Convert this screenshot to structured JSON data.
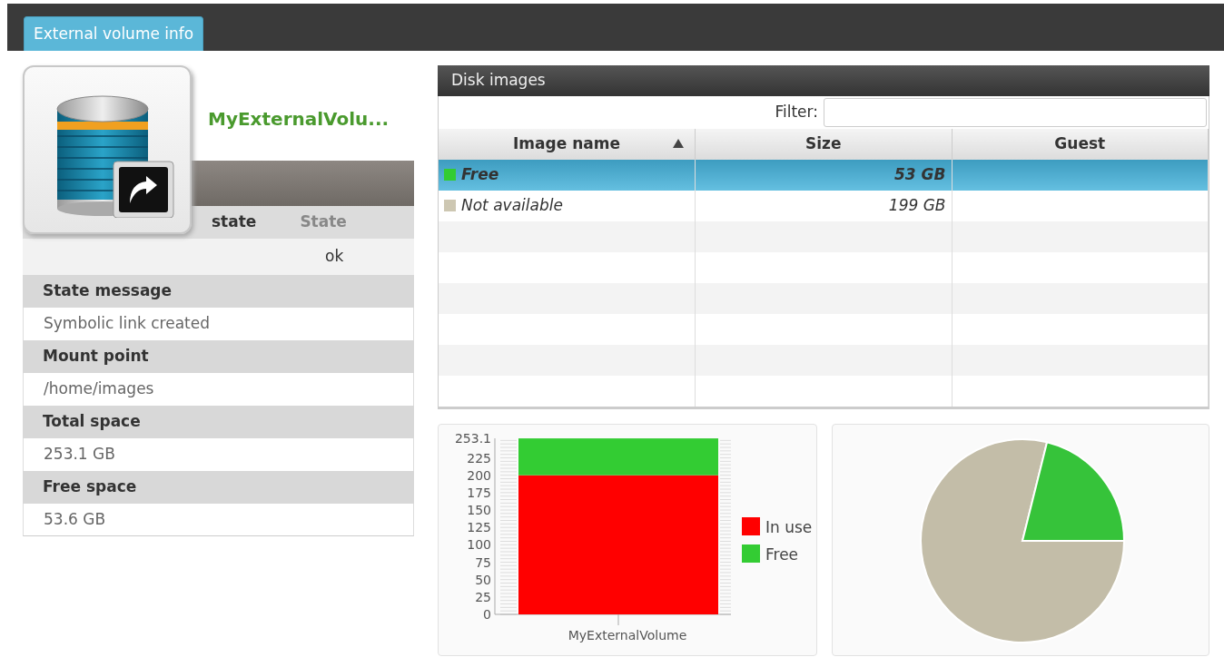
{
  "tabs": [
    {
      "label": "External volume info",
      "selected": true
    }
  ],
  "volume": {
    "name": "MyExternalVolu...",
    "header": [
      "state",
      "State"
    ],
    "state_value": "ok",
    "fields": [
      {
        "label": "State message",
        "value": "Symbolic link created"
      },
      {
        "label": "Mount point",
        "value": "/home/images"
      },
      {
        "label": "Total space",
        "value": "253.1 GB"
      },
      {
        "label": "Free space",
        "value": "53.6 GB"
      }
    ]
  },
  "disk_images": {
    "title": "Disk images",
    "filter": {
      "label": "Filter:"
    },
    "columns": [
      {
        "label": "Image name",
        "sorted": true
      },
      {
        "label": "Size",
        "sorted": false
      },
      {
        "label": "Guest",
        "sorted": false
      }
    ],
    "rows": [
      {
        "name": "Free",
        "size": "53 GB",
        "color": "#33cc33",
        "selected": true
      },
      {
        "name": "Not available",
        "size": "199 GB",
        "color": "#cdc7b2",
        "selected": false
      }
    ]
  },
  "bar_chart": {
    "chart_data": {
      "type": "bar",
      "stacked": true,
      "categories": [
        "MyExternalVolume"
      ],
      "series": [
        {
          "name": "In use",
          "color": "#ff0000",
          "values": [
            200
          ]
        },
        {
          "name": "Free",
          "color": "#33cc33",
          "values": [
            53
          ]
        }
      ],
      "legend": "right",
      "ylim": [
        0,
        253.1
      ],
      "yticks": [
        0,
        25,
        50,
        75,
        100,
        125,
        150,
        175,
        200,
        225,
        253.1
      ]
    }
  }
}
